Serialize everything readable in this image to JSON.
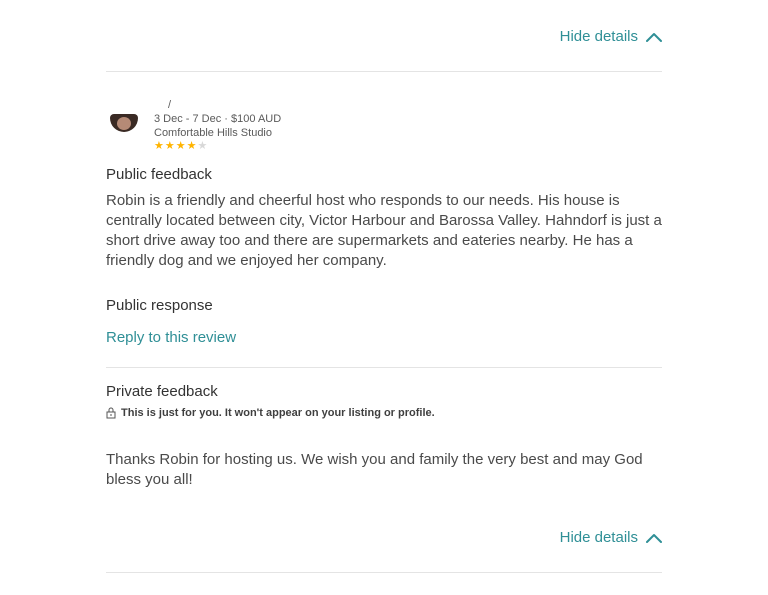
{
  "header": {
    "hide_details_label": "Hide details"
  },
  "review": {
    "reviewer_name": "/",
    "stay_line": "3 Dec - 7 Dec · $100 AUD",
    "listing_name": "Comfortable Hills Studio",
    "rating": 4,
    "rating_max": 5
  },
  "public_feedback": {
    "title": "Public feedback",
    "text": "Robin is a friendly and cheerful host who responds to our needs. His house is centrally located between city, Victor Harbour and Barossa Valley. Hahndorf is just a short drive away too and there are supermarkets and eateries nearby. He has a friendly dog and we enjoyed her company."
  },
  "public_response": {
    "title": "Public response",
    "reply_label": "Reply to this review"
  },
  "private_feedback": {
    "title": "Private feedback",
    "note": "This is just for you. It won't appear on your listing or profile.",
    "text": "Thanks Robin for hosting us. We wish you and family the very best and may God bless you all!"
  },
  "footer": {
    "hide_details_label": "Hide details"
  },
  "icons": {
    "hide_details": "chevron-up-icon",
    "private_note": "lock-icon",
    "rating": "star-icon"
  },
  "colors": {
    "accent": "#2f8f96",
    "star_filled": "#ffb400",
    "star_empty": "#d8d8d8"
  }
}
